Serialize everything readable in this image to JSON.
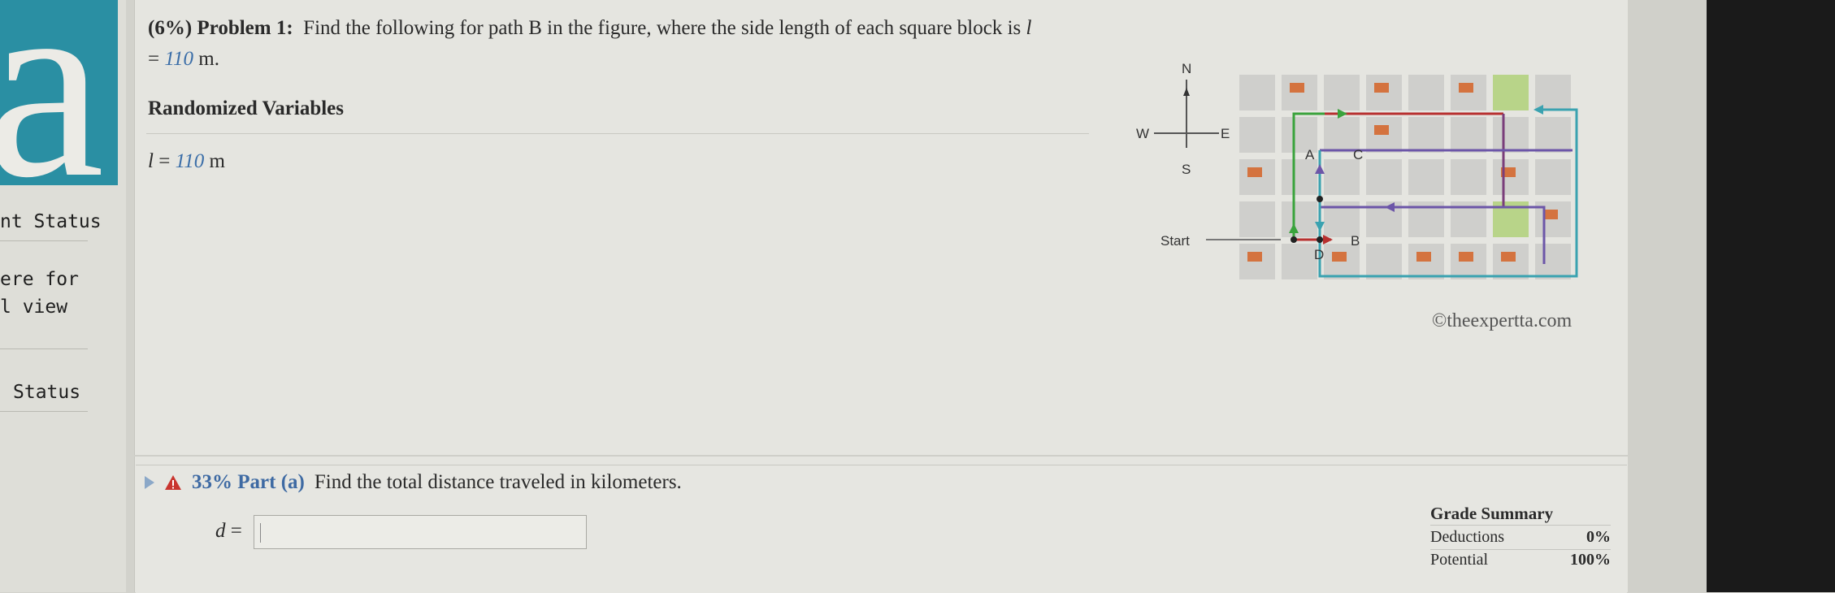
{
  "sidebar": {
    "items": [
      {
        "label": "nt Status"
      },
      {
        "label": "ere for"
      },
      {
        "label": "l view"
      },
      {
        "label": "Status"
      }
    ]
  },
  "problem": {
    "prefix": "(6%) Problem 1:",
    "text": "Find the following for path B in the figure, where the side length of each square block is",
    "var": "l",
    "eq": "= ",
    "value": "110",
    "unit": " m."
  },
  "randomized": {
    "title": "Randomized Variables",
    "var": "l",
    "eq": " = ",
    "value": "110",
    "unit": " m"
  },
  "figure": {
    "compass": {
      "n": "N",
      "s": "S",
      "e": "E",
      "w": "W"
    },
    "start_label": "Start",
    "points": {
      "a": "A",
      "b": "B",
      "c": "C",
      "d": "D"
    },
    "copyright": "©theexpertta.com",
    "colors": {
      "path_red": "#b8302f",
      "path_green": "#3aa33c",
      "path_purple": "#6c56a8",
      "path_teal": "#3aa2b0",
      "block": "#cfcfcc",
      "building": "#d4733f",
      "park": "#b8d489"
    }
  },
  "part_a": {
    "percent": "33%",
    "label": "Part (a)",
    "prompt": "Find the total distance traveled in kilometers.",
    "answer_var": "d",
    "answer_eq": " =",
    "answer_value": ""
  },
  "grade_summary": {
    "title": "Grade Summary",
    "rows": [
      {
        "label": "Deductions",
        "value": "0%"
      },
      {
        "label": "Potential",
        "value": "100%"
      }
    ]
  }
}
